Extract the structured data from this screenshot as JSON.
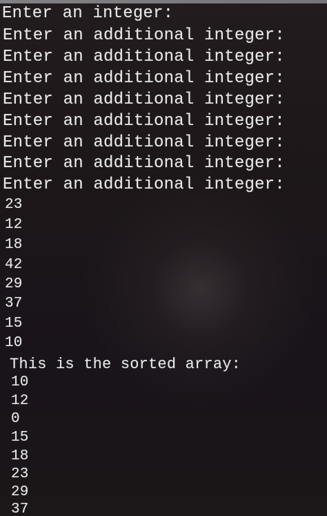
{
  "terminal": {
    "prompts": [
      "Enter an integer:",
      "Enter an additional integer:",
      "Enter an additional integer:",
      "Enter an additional integer:",
      "Enter an additional integer:",
      "Enter an additional integer:",
      "Enter an additional integer:",
      "Enter an additional integer:",
      "Enter an additional integer:"
    ],
    "inputs": [
      "23",
      "12",
      "18",
      "42",
      "29",
      "37",
      "15",
      "10"
    ],
    "sorted_heading": "This is the sorted array:",
    "sorted_output": [
      "10",
      "12",
      "0",
      "15",
      "18",
      "23",
      "29",
      "37"
    ]
  }
}
